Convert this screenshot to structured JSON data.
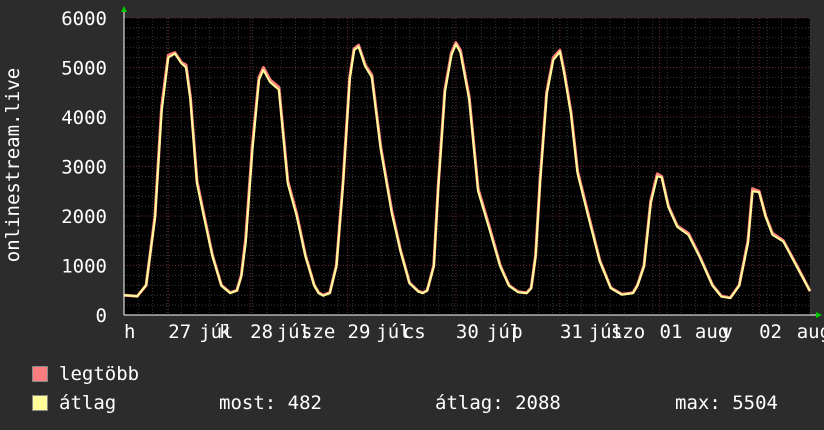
{
  "colors": {
    "background": "#2c2c2c",
    "plot_background": "#000000",
    "grid_major": "#6e2a2a",
    "grid_minor": "#3a3a3a",
    "series_max": "#ff7f7f",
    "series_avg": "#ffff99",
    "text": "#ffffff",
    "arrow": "#00cc00"
  },
  "chart_data": {
    "type": "line",
    "title": "",
    "xlabel": "",
    "ylabel": "onlinestream.live",
    "ylim": [
      0,
      6000
    ],
    "yticks": [
      0,
      1000,
      2000,
      3000,
      4000,
      5000,
      6000
    ],
    "grid": true,
    "xlim": [
      0,
      152
    ],
    "x_unit_note": "",
    "xtick_labels": [
      {
        "x": 0,
        "label": "h"
      },
      {
        "x": 20,
        "label": "27"
      },
      {
        "x": 34,
        "label": "júl"
      },
      {
        "x": 43,
        "label": "k"
      },
      {
        "x": 57,
        "label": "28"
      },
      {
        "x": 69,
        "label": "júl"
      },
      {
        "x": 80,
        "label": "sze"
      },
      {
        "x": 101,
        "label": "29"
      },
      {
        "x": 114,
        "label": "júl"
      },
      {
        "x": 126,
        "label": "cs"
      },
      {
        "x": 150,
        "label": "30"
      },
      {
        "x": 164,
        "label": "júl"
      },
      {
        "x": 175,
        "label": "p"
      },
      {
        "x": 197,
        "label": "31"
      },
      {
        "x": 210,
        "label": "júl"
      },
      {
        "x": 220,
        "label": "szo"
      },
      {
        "x": 242,
        "label": "01"
      },
      {
        "x": 258,
        "label": "aug"
      },
      {
        "x": 270,
        "label": "v"
      },
      {
        "x": 287,
        "label": "02"
      },
      {
        "x": 304,
        "label": "aug"
      }
    ],
    "series": [
      {
        "name": "legtöbb",
        "color": "#ff7f7f",
        "x": [
          0,
          6,
          10,
          14,
          17,
          20,
          23,
          26,
          28,
          30,
          33,
          36,
          40,
          44,
          48,
          51,
          53,
          55,
          58,
          61,
          63,
          66,
          70,
          74,
          78,
          82,
          86,
          88,
          90,
          93,
          96,
          99,
          102,
          104,
          106,
          109,
          112,
          116,
          121,
          125,
          129,
          133,
          135,
          137,
          140,
          142,
          145,
          148,
          150,
          152,
          156,
          160,
          165,
          170,
          174,
          178,
          182,
          184,
          186,
          188,
          191,
          194,
          197,
          199,
          202,
          205,
          210,
          215,
          220,
          225,
          230,
          232,
          235,
          238,
          241,
          243,
          246,
          250,
          255,
          260,
          266,
          270,
          274,
          278,
          282,
          284,
          287,
          290,
          293,
          298,
          304,
          310
        ],
        "y": [
          400,
          380,
          600,
          2000,
          4200,
          5250,
          5300,
          5100,
          5050,
          4400,
          2700,
          2050,
          1200,
          600,
          450,
          500,
          800,
          1550,
          3400,
          4800,
          5000,
          4750,
          4600,
          2700,
          2050,
          1200,
          600,
          450,
          400,
          450,
          1000,
          2700,
          4800,
          5380,
          5450,
          5050,
          4850,
          3400,
          2100,
          1300,
          650,
          480,
          450,
          500,
          1000,
          2600,
          4550,
          5300,
          5504,
          5350,
          4400,
          2550,
          1800,
          1000,
          600,
          470,
          450,
          550,
          1200,
          2700,
          4500,
          5200,
          5350,
          4900,
          4100,
          2900,
          2000,
          1100,
          550,
          420,
          450,
          600,
          1000,
          2300,
          2850,
          2800,
          2200,
          1800,
          1650,
          1200,
          600,
          380,
          350,
          600,
          1500,
          2550,
          2500,
          2000,
          1650,
          1500,
          1000,
          482
        ]
      },
      {
        "name": "átlag",
        "color": "#ffff99",
        "x": [
          0,
          6,
          10,
          14,
          17,
          20,
          23,
          26,
          28,
          30,
          33,
          36,
          40,
          44,
          48,
          51,
          53,
          55,
          58,
          61,
          63,
          66,
          70,
          74,
          78,
          82,
          86,
          88,
          90,
          93,
          96,
          99,
          102,
          104,
          106,
          109,
          112,
          116,
          121,
          125,
          129,
          133,
          135,
          137,
          140,
          142,
          145,
          148,
          150,
          152,
          156,
          160,
          165,
          170,
          174,
          178,
          182,
          184,
          186,
          188,
          191,
          194,
          197,
          199,
          202,
          205,
          210,
          215,
          220,
          225,
          230,
          232,
          235,
          238,
          241,
          243,
          246,
          250,
          255,
          260,
          266,
          270,
          274,
          278,
          282,
          284,
          287,
          290,
          293,
          298,
          304,
          310
        ],
        "y": [
          400,
          380,
          600,
          1950,
          4100,
          5200,
          5280,
          5080,
          5000,
          4350,
          2650,
          2000,
          1180,
          590,
          440,
          490,
          780,
          1450,
          3300,
          4750,
          4950,
          4700,
          4550,
          2650,
          2000,
          1180,
          590,
          440,
          390,
          440,
          980,
          2650,
          4750,
          5350,
          5420,
          5020,
          4800,
          3350,
          2050,
          1280,
          640,
          470,
          440,
          490,
          980,
          2550,
          4500,
          5250,
          5470,
          5300,
          4350,
          2500,
          1750,
          980,
          590,
          460,
          440,
          540,
          1180,
          2650,
          4450,
          5150,
          5320,
          4850,
          4050,
          2850,
          1950,
          1080,
          540,
          410,
          440,
          590,
          980,
          2250,
          2800,
          2780,
          2180,
          1780,
          1620,
          1180,
          590,
          370,
          340,
          590,
          1450,
          2500,
          2480,
          1980,
          1620,
          1480,
          980,
          482
        ]
      }
    ]
  },
  "legend": [
    {
      "label": "legtöbb",
      "color": "#ff7f7f"
    },
    {
      "label": "átlag",
      "color": "#ffff99"
    }
  ],
  "stats": {
    "most": "most: 482",
    "atlag": "átlag: 2088",
    "max": "max: 5504"
  }
}
